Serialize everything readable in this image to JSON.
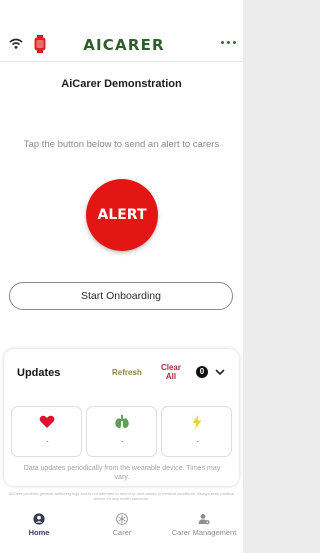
{
  "header": {
    "brand": "AICARER"
  },
  "page": {
    "title": "AiCarer Demonstration",
    "instruction": "Tap the button below to send an alert to carers",
    "alert_label": "ALERT",
    "onboarding_label": "Start Onboarding"
  },
  "updates": {
    "title": "Updates",
    "refresh_label": "Refresh",
    "clear_label": "Clear All",
    "count": "0",
    "tiles": [
      {
        "icon": "heart-icon",
        "value": "-"
      },
      {
        "icon": "lungs-icon",
        "value": "-"
      },
      {
        "icon": "lightning-icon",
        "value": "-"
      }
    ],
    "note": "Data updates periodically from the wearable device. Times may vary."
  },
  "disclaimer": "AiCarer provides general wellbeing logs and is not intended to detect or alert carers to medical conditions. Always seek medical advice for any health concerns.",
  "nav": [
    {
      "label": "Home",
      "icon": "person-icon",
      "active": true
    },
    {
      "label": "Carer",
      "icon": "snowflake-icon",
      "active": false
    },
    {
      "label": "Carer Management",
      "icon": "person-settings-icon",
      "active": false
    }
  ],
  "colors": {
    "brand": "#2f5d2c",
    "alert": "#e31515",
    "refresh": "#8a8a3a",
    "clear": "#b3273d",
    "heart": "#d9142c",
    "lungs": "#3f8a3f",
    "bolt": "#e8d22a"
  }
}
